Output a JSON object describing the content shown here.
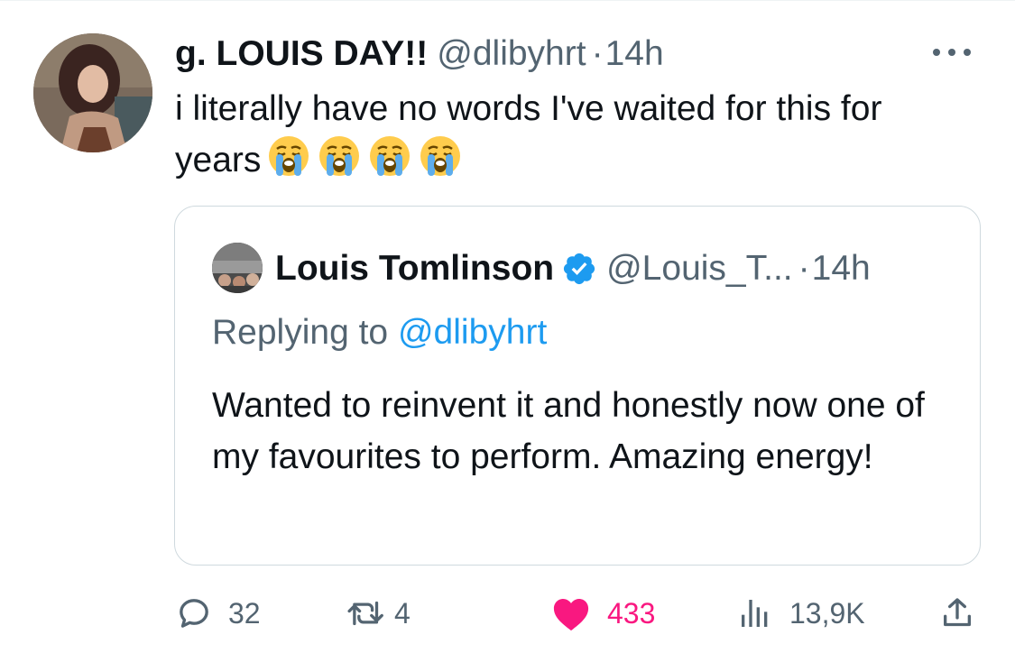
{
  "tweet": {
    "author_name": "g. LOUIS DAY!!",
    "author_handle": "@dlibyhrt",
    "separator": "·",
    "timestamp": "14h",
    "more_icon": "ellipsis-icon",
    "text": "i literally have no words I've waited for this for years",
    "emoji": [
      "😭",
      "😭",
      "😭",
      "😭"
    ]
  },
  "quote": {
    "author_name": "Louis Tomlinson",
    "verified_icon": "verified-badge-icon",
    "author_handle": "@Louis_T...",
    "separator": "·",
    "timestamp": "14h",
    "replying_prefix": "Replying to",
    "replying_handle": "@dlibyhrt",
    "text": "Wanted to reinvent it and honestly now one of my favourites to perform. Amazing energy!"
  },
  "actions": {
    "reply": {
      "icon": "reply-icon",
      "count": "32"
    },
    "retweet": {
      "icon": "retweet-icon",
      "count": "4"
    },
    "like": {
      "icon": "heart-icon",
      "count": "433"
    },
    "views": {
      "icon": "views-icon",
      "count": "13,9K"
    },
    "share": {
      "icon": "share-icon"
    }
  },
  "colors": {
    "text": "#0f1419",
    "secondary": "#536471",
    "link": "#1d9bf0",
    "like": "#f91880",
    "border": "#cfd9de"
  }
}
